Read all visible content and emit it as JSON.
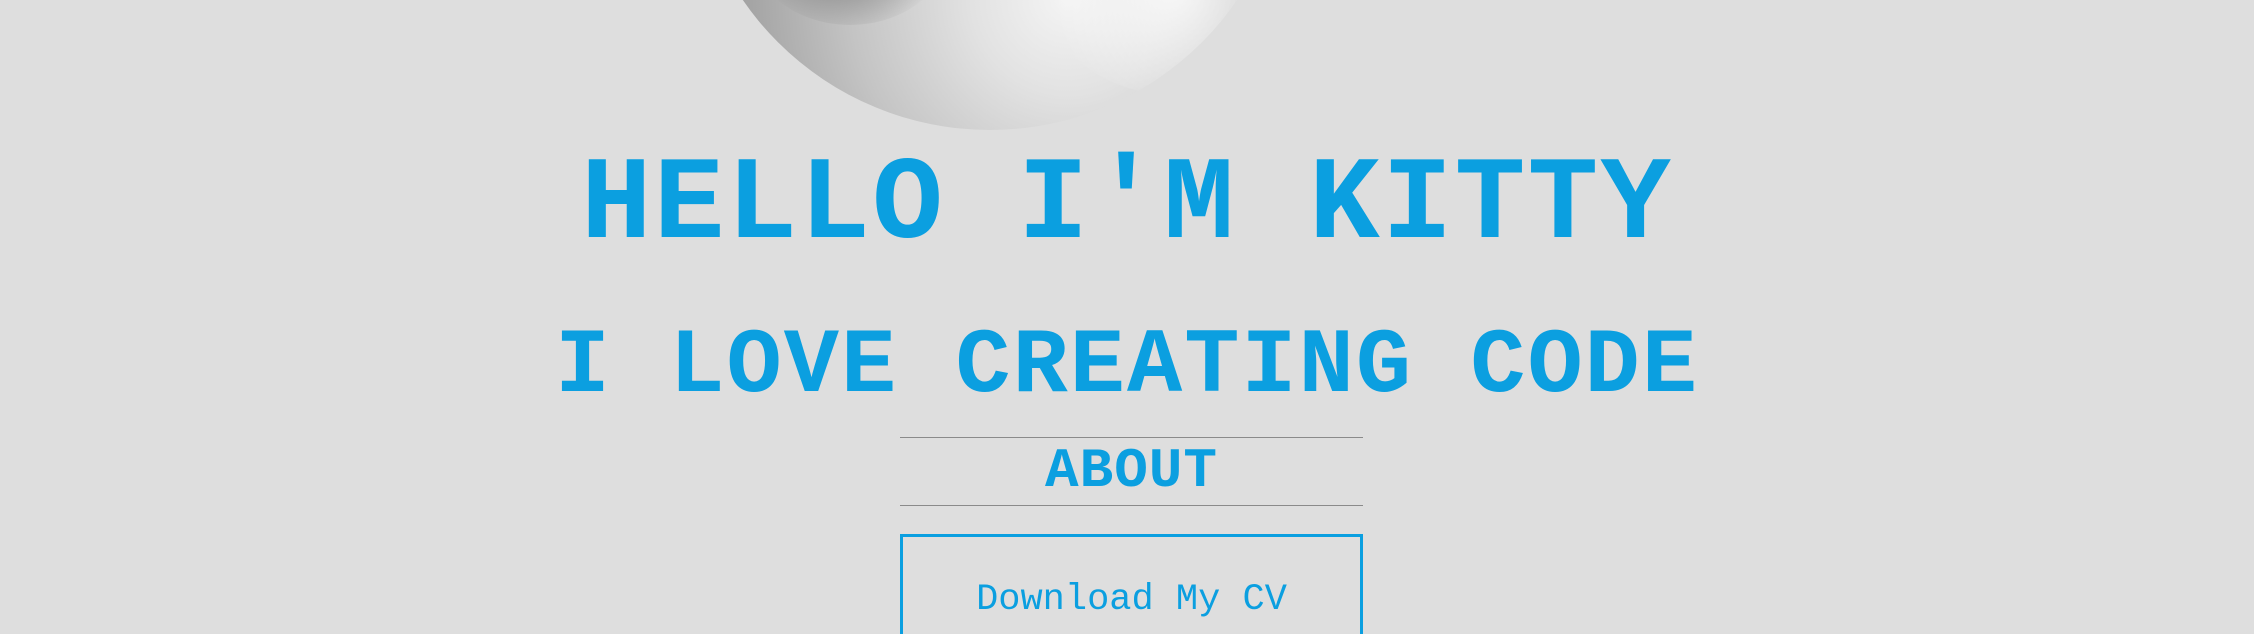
{
  "hero": {
    "title": "HELLO I'M KITTY",
    "subtitle": "I LOVE CREATING CODE"
  },
  "nav": {
    "about_label": "ABOUT"
  },
  "actions": {
    "download_cv_label": "Download My CV"
  },
  "colors": {
    "background": "#dedede",
    "accent": "#0b9fe0",
    "divider": "#8a8a8a"
  }
}
